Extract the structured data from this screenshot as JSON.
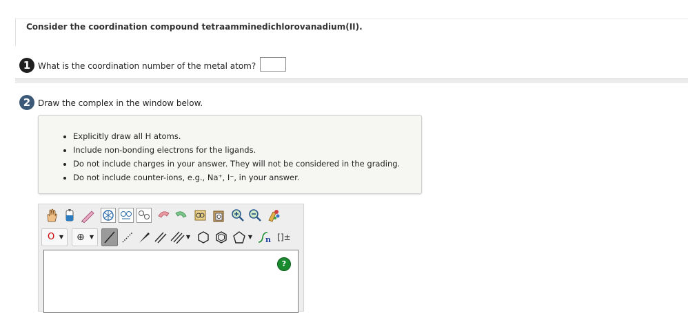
{
  "header": {
    "title": "Consider the coordination compound tetraamminedichlorovanadium(II)."
  },
  "question1": {
    "number": "1",
    "text": "What is the coordination number of the metal atom?",
    "answer_value": ""
  },
  "question2": {
    "number": "2",
    "text": "Draw the complex in the window below."
  },
  "instructions": {
    "items": [
      "Explicitly draw all H atoms.",
      "Include non-bonding electrons for the ligands.",
      "Do not include charges in your answer. They will not be considered in the grading.",
      "Do not include counter-ions, e.g., Na⁺, I⁻, in your answer."
    ]
  },
  "editor": {
    "toolbar_row1": [
      "hand-icon",
      "eraser-icon",
      "pencil-icon",
      "ring-template-icon",
      "template-2-icon",
      "template-3-icon",
      "undo-icon",
      "redo-icon",
      "copy-icon",
      "paste-icon",
      "zoom-in-icon",
      "zoom-out-icon",
      "clean-icon"
    ],
    "atom_label": "O",
    "charge_symbol": "⊕",
    "attachment_label": "n",
    "bracket_label": "[]±",
    "help_label": "?"
  },
  "colors": {
    "q1_badge": "#1f1f1f",
    "q2_badge": "#3c5a78",
    "atom_red": "#cc0000",
    "help_green": "#1a8a2e"
  }
}
